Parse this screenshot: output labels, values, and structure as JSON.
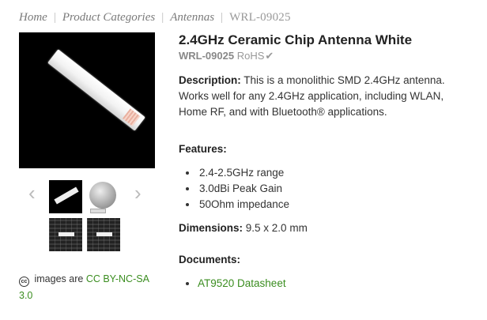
{
  "breadcrumb": {
    "items": [
      "Home",
      "Product Categories",
      "Antennas"
    ],
    "current": "WRL-09025",
    "separator": "|"
  },
  "gallery": {
    "prev_icon": "‹",
    "next_icon": "›"
  },
  "license": {
    "icon_text": "cc",
    "prefix": "images are",
    "link": "CC BY-NC-SA 3.0"
  },
  "product": {
    "title": "2.4GHz Ceramic Chip Antenna White",
    "sku": "WRL-09025",
    "rohs": "RoHS",
    "rohs_check": "✔",
    "description_label": "Description:",
    "description": "This is a monolithic SMD 2.4GHz antenna. Works well for any 2.4GHz application, including WLAN, Home RF, and with Bluetooth® applications.",
    "features_label": "Features:",
    "features": [
      "2.4-2.5GHz range",
      "3.0dBi Peak Gain",
      "50Ohm impedance"
    ],
    "dimensions_label": "Dimensions:",
    "dimensions": "9.5 x 2.0 mm",
    "documents_label": "Documents:",
    "documents": [
      "AT9520 Datasheet"
    ]
  },
  "colors": {
    "link_green": "#3a8d1f",
    "muted_gray": "#888888"
  }
}
